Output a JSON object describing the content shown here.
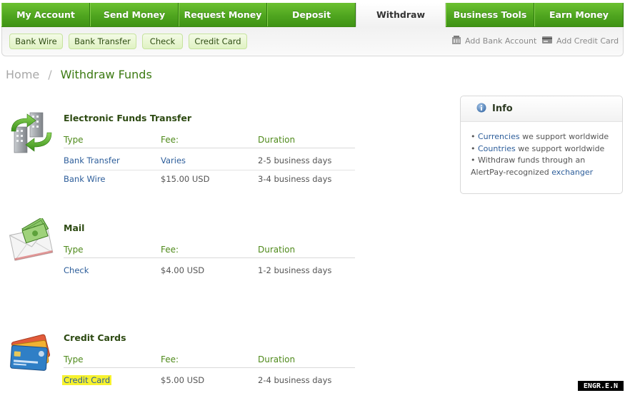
{
  "nav": {
    "tabs": [
      {
        "label": "My Account",
        "active": false
      },
      {
        "label": "Send Money",
        "active": false
      },
      {
        "label": "Request Money",
        "active": false
      },
      {
        "label": "Deposit",
        "active": false
      },
      {
        "label": "Withdraw",
        "active": true
      },
      {
        "label": "Business Tools",
        "active": false
      },
      {
        "label": "Earn Money",
        "active": false
      }
    ]
  },
  "subnav": {
    "pills": [
      "Bank Wire",
      "Bank Transfer",
      "Check",
      "Credit Card"
    ],
    "add_bank": "Add Bank Account",
    "add_card": "Add Credit Card"
  },
  "breadcrumb": {
    "home": "Home",
    "separator": "/",
    "current": "Withdraw Funds"
  },
  "sections": [
    {
      "title": "Electronic Funds Transfer",
      "icon": "bank-transfer-icon",
      "headers": [
        "Type",
        "Fee:",
        "Duration"
      ],
      "rows": [
        {
          "type": "Bank Transfer",
          "fee": "Varies",
          "duration": "2-5 business days"
        },
        {
          "type": "Bank Wire",
          "fee": "$15.00 USD",
          "duration": "3-4 business days"
        }
      ]
    },
    {
      "title": "Mail",
      "icon": "mail-money-icon",
      "headers": [
        "Type",
        "Fee:",
        "Duration"
      ],
      "rows": [
        {
          "type": "Check",
          "fee": "$4.00 USD",
          "duration": "1-2 business days"
        }
      ]
    },
    {
      "title": "Credit Cards",
      "icon": "credit-cards-icon",
      "headers": [
        "Type",
        "Fee:",
        "Duration"
      ],
      "rows": [
        {
          "type": "Credit Card",
          "fee": "$5.00 USD",
          "duration": "2-4 business days",
          "highlighted": true
        }
      ]
    }
  ],
  "info": {
    "title": "Info",
    "items": [
      {
        "link": "Currencies",
        "text": " we support worldwide"
      },
      {
        "link": "Countries",
        "text": " we support worldwide"
      },
      {
        "text": "Withdraw funds through an"
      },
      {
        "text": "AlertPay-recognized ",
        "link": "exchanger"
      }
    ],
    "bullet": "•"
  },
  "watermark": "ENGR.E.N",
  "colors": {
    "nav_green": "#4fa51f",
    "title_green": "#3c7a12",
    "link_blue": "#2c5d9a",
    "highlight": "#f7f22e"
  }
}
